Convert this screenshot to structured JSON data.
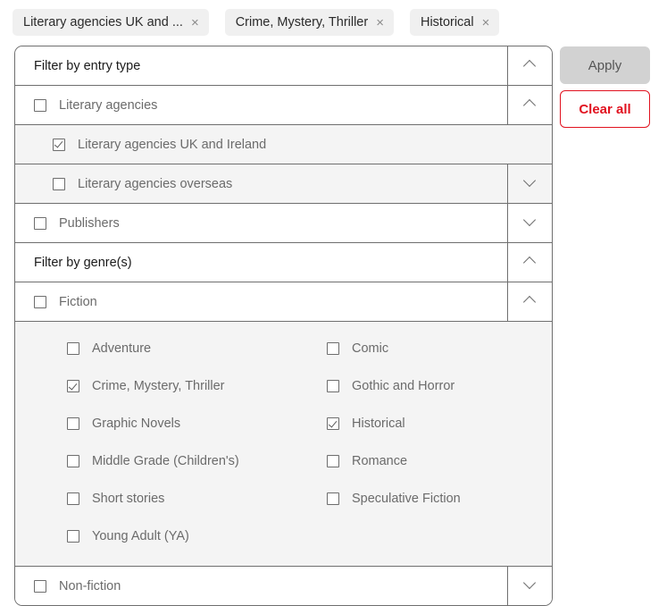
{
  "chips": [
    {
      "label": "Literary agencies UK and ...",
      "close": "×"
    },
    {
      "label": "Crime, Mystery, Thriller",
      "close": "×"
    },
    {
      "label": "Historical",
      "close": "×"
    }
  ],
  "actions": {
    "apply_label": "Apply",
    "clear_label": "Clear all",
    "accent_red": "#e1121f",
    "apply_bg": "#d2d2d2"
  },
  "panel": {
    "entry_type": {
      "title": "Filter by entry type",
      "expanded": true,
      "items": [
        {
          "label": "Literary agencies",
          "checked": false,
          "expanded": true,
          "children": [
            {
              "label": "Literary agencies UK and Ireland",
              "checked": true,
              "has_toggle": false
            },
            {
              "label": "Literary agencies overseas",
              "checked": false,
              "has_toggle": true,
              "expanded": false
            }
          ]
        },
        {
          "label": "Publishers",
          "checked": false,
          "expanded": false,
          "children": []
        }
      ]
    },
    "genres": {
      "title": "Filter by genre(s)",
      "expanded": true,
      "fiction": {
        "label": "Fiction",
        "checked": false,
        "expanded": true,
        "options": [
          {
            "label": "Adventure",
            "checked": false
          },
          {
            "label": "Comic",
            "checked": false
          },
          {
            "label": "Crime, Mystery, Thriller",
            "checked": true
          },
          {
            "label": "Gothic and Horror",
            "checked": false
          },
          {
            "label": "Graphic Novels",
            "checked": false
          },
          {
            "label": "Historical",
            "checked": true
          },
          {
            "label": "Middle Grade (Children's)",
            "checked": false
          },
          {
            "label": "Romance",
            "checked": false
          },
          {
            "label": "Short stories",
            "checked": false
          },
          {
            "label": "Speculative Fiction",
            "checked": false
          },
          {
            "label": "Young Adult (YA)",
            "checked": false
          },
          {
            "label": "",
            "checked": false,
            "empty": true
          }
        ]
      },
      "nonfiction": {
        "label": "Non-fiction",
        "checked": false,
        "expanded": false
      }
    }
  }
}
